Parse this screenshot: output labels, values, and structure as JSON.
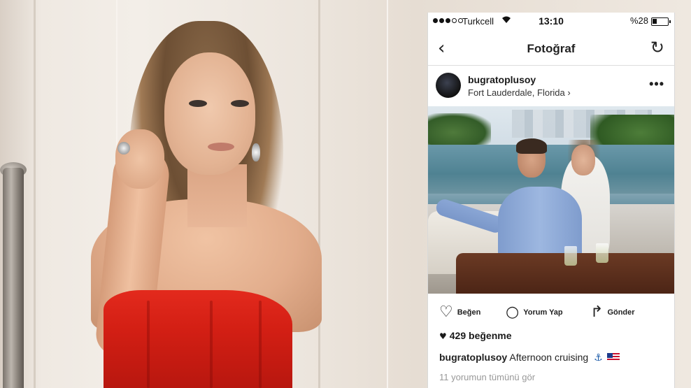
{
  "status_bar": {
    "carrier": "Turkcell",
    "time": "13:10",
    "battery": "%28",
    "wifi_icon": "wifi-icon"
  },
  "nav": {
    "back_icon": "‹",
    "title": "Fotoğraf",
    "refresh_icon": "↻"
  },
  "post": {
    "username": "bugratoplusoy",
    "location": "Fort Lauderdale, Florida ›",
    "more": "•••",
    "actions": {
      "like_label": "Beğen",
      "comment_label": "Yorum Yap",
      "share_label": "Gönder"
    },
    "likes": "429 beğenme",
    "caption_user": "bugratoplusoy",
    "caption_text": "Afternoon cruising",
    "view_comments": "11 yorumun tümünü gör"
  },
  "colors": {
    "dress": "#d31f14",
    "phone_bg": "#ffffff",
    "muted_text": "#999999"
  }
}
